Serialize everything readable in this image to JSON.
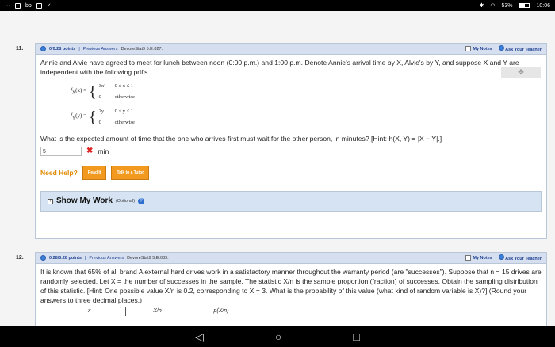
{
  "status_bar": {
    "left_icons": [
      "...",
      "icon",
      "icon",
      "a",
      "check"
    ],
    "battery": "53%",
    "time": "10:06"
  },
  "q11": {
    "number": "11.",
    "points": "0/0.28 points",
    "previous": "Previous Answers",
    "source": "DevoreStat9 5.E.027.",
    "my_notes": "My Notes",
    "ask_teacher": "Ask Your Teacher",
    "text": "Annie and Alvie have agreed to meet for lunch between noon (0:00 p.m.) and 1:00 p.m. Denote Annie's arrival time by X, Alvie's by Y, and suppose X and Y are independent with the following pdf's.",
    "fx_label": "f",
    "fx_sub": "X",
    "fx_arg": "(x) =",
    "fx_case1_expr": "3x²",
    "fx_case1_cond": "0 ≤ x ≤ 1",
    "fx_case2_expr": "0",
    "fx_case2_cond": "otherwise",
    "fy_label": "f",
    "fy_sub": "Y",
    "fy_arg": "(y) =",
    "fy_case1_expr": "2y",
    "fy_case1_cond": "0 ≤ y ≤ 1",
    "fy_case2_expr": "0",
    "fy_case2_cond": "otherwise",
    "question": "What is the expected amount of time that the one who arrives first must wait for the other person, in minutes? [Hint: h(X, Y) = |X − Y|.]",
    "answer_value": "5",
    "unit": "min",
    "need_help": "Need Help?",
    "read_it": "Read It",
    "talk_tutor": "Talk to a Tutor",
    "show_work": "Show My Work",
    "optional": "(Optional)"
  },
  "q12": {
    "number": "12.",
    "points": "0.28/0.28 points",
    "previous": "Previous Answers",
    "source": "DevoreStat9 5.E.039.",
    "my_notes": "My Notes",
    "ask_teacher": "Ask Your Teacher",
    "text": "It is known that 65% of all brand A external hard drives work in a satisfactory manner throughout the warranty period (are \"successes\"). Suppose that n = 15 drives are randomly selected. Let X = the number of successes in the sample. The statistic X/n is the sample proportion (fraction) of successes. Obtain the sampling distribution of this statistic. [Hint: One possible value X/n is 0.2, corresponding to X = 3. What is the probability of this value (what kind of random variable is X)?] (Round your answers to three decimal places.)",
    "col_x": "x",
    "col_xn": "X/n",
    "col_pxn": "p(X/n)"
  },
  "nav": {
    "back": "◁",
    "home": "○",
    "recents": "□"
  }
}
